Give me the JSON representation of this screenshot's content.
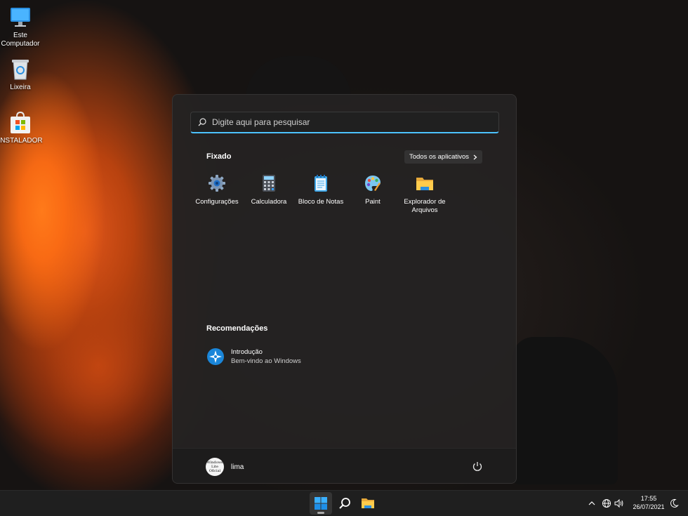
{
  "desktop": {
    "icons": [
      {
        "label": "Este Computador",
        "icon": "monitor-icon"
      },
      {
        "label": "Lixeira",
        "icon": "recycle-bin-icon"
      },
      {
        "label": "INSTALADOR",
        "icon": "store-bag-icon"
      }
    ]
  },
  "start_menu": {
    "search_placeholder": "Digite aqui para pesquisar",
    "pinned_title": "Fixado",
    "all_apps_label": "Todos os aplicativos",
    "pinned_apps": [
      {
        "label": "Configurações",
        "icon": "gear-icon"
      },
      {
        "label": "Calculadora",
        "icon": "calculator-icon"
      },
      {
        "label": "Bloco de Notas",
        "icon": "notepad-icon"
      },
      {
        "label": "Paint",
        "icon": "paint-palette-icon"
      },
      {
        "label": "Explorador de Arquivos",
        "icon": "folder-icon"
      }
    ],
    "recommended_title": "Recomendações",
    "recommended": [
      {
        "title": "Introdução",
        "subtitle": "Bem-vindo ao Windows",
        "icon": "get-started-icon"
      }
    ],
    "user": {
      "name": "lima",
      "avatar_text": "Windows Lite Oficial"
    }
  },
  "taskbar": {
    "buttons": [
      "start-icon",
      "search-icon",
      "file-explorer-icon"
    ],
    "clock": {
      "time": "17:55",
      "date": "26/07/2021"
    }
  },
  "colors": {
    "accent": "#4cc2ff",
    "menu_bg": "#242222",
    "taskbar_bg": "#202020"
  }
}
